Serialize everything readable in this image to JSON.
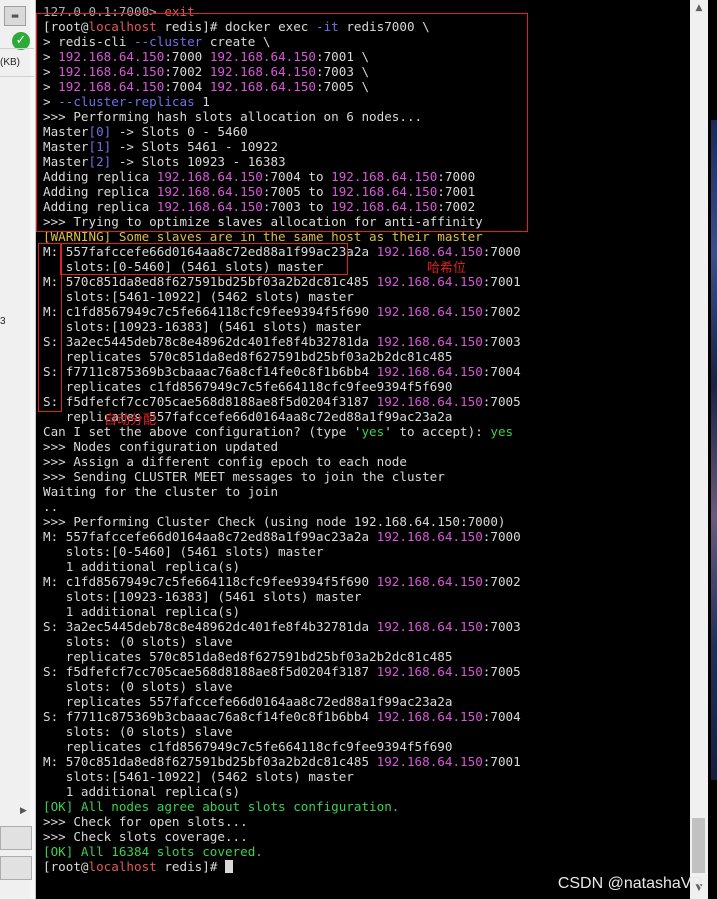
{
  "left_panel": {
    "kb_label": "(KB)",
    "number_label": "3"
  },
  "terminal": {
    "lines": [
      [
        {
          "t": "127.0.0.1:7000> ",
          "c": "c-dim"
        },
        {
          "t": "exit",
          "c": "c-red"
        }
      ],
      [
        {
          "t": "[root@",
          "c": ""
        },
        {
          "t": "localhost",
          "c": "c-red"
        },
        {
          "t": " redis]# docker exec ",
          "c": ""
        },
        {
          "t": "-it",
          "c": "c-cyn"
        },
        {
          "t": " redis7000 \\",
          "c": ""
        }
      ],
      [
        {
          "t": "> redis-cli ",
          "c": ""
        },
        {
          "t": "--cluster",
          "c": "c-cyn"
        },
        {
          "t": " create \\",
          "c": ""
        }
      ],
      [
        {
          "t": "> ",
          "c": ""
        },
        {
          "t": "192.168.64.150",
          "c": "c-mag"
        },
        {
          "t": ":7000 ",
          "c": ""
        },
        {
          "t": "192.168.64.150",
          "c": "c-mag"
        },
        {
          "t": ":7001 \\",
          "c": ""
        }
      ],
      [
        {
          "t": "> ",
          "c": ""
        },
        {
          "t": "192.168.64.150",
          "c": "c-mag"
        },
        {
          "t": ":7002 ",
          "c": ""
        },
        {
          "t": "192.168.64.150",
          "c": "c-mag"
        },
        {
          "t": ":7003 \\",
          "c": ""
        }
      ],
      [
        {
          "t": "> ",
          "c": ""
        },
        {
          "t": "192.168.64.150",
          "c": "c-mag"
        },
        {
          "t": ":7004 ",
          "c": ""
        },
        {
          "t": "192.168.64.150",
          "c": "c-mag"
        },
        {
          "t": ":7005 \\",
          "c": ""
        }
      ],
      [
        {
          "t": "> ",
          "c": ""
        },
        {
          "t": "--cluster-replicas",
          "c": "c-cyn"
        },
        {
          "t": " 1",
          "c": ""
        }
      ],
      [
        {
          "t": ">>> Performing hash slots allocation on 6 nodes...",
          "c": ""
        }
      ],
      [
        {
          "t": "Master",
          "c": ""
        },
        {
          "t": "[0]",
          "c": "c-cyn"
        },
        {
          "t": " -> Slots 0 - 5460",
          "c": ""
        }
      ],
      [
        {
          "t": "Master",
          "c": ""
        },
        {
          "t": "[1]",
          "c": "c-cyn"
        },
        {
          "t": " -> Slots 5461 - 10922",
          "c": ""
        }
      ],
      [
        {
          "t": "Master",
          "c": ""
        },
        {
          "t": "[2]",
          "c": "c-cyn"
        },
        {
          "t": " -> Slots 10923 - 16383",
          "c": ""
        }
      ],
      [
        {
          "t": "Adding replica ",
          "c": ""
        },
        {
          "t": "192.168.64.150",
          "c": "c-mag"
        },
        {
          "t": ":7004 to ",
          "c": ""
        },
        {
          "t": "192.168.64.150",
          "c": "c-mag"
        },
        {
          "t": ":7000",
          "c": ""
        }
      ],
      [
        {
          "t": "Adding replica ",
          "c": ""
        },
        {
          "t": "192.168.64.150",
          "c": "c-mag"
        },
        {
          "t": ":7005 to ",
          "c": ""
        },
        {
          "t": "192.168.64.150",
          "c": "c-mag"
        },
        {
          "t": ":7001",
          "c": ""
        }
      ],
      [
        {
          "t": "Adding replica ",
          "c": ""
        },
        {
          "t": "192.168.64.150",
          "c": "c-mag"
        },
        {
          "t": ":7003 to ",
          "c": ""
        },
        {
          "t": "192.168.64.150",
          "c": "c-mag"
        },
        {
          "t": ":7002",
          "c": ""
        }
      ],
      [
        {
          "t": ">>> Trying to optimize slaves allocation for anti-affinity",
          "c": ""
        }
      ],
      [
        {
          "t": "[WARNING] Some slaves are in the same host as their master",
          "c": "c-yel"
        }
      ],
      [
        {
          "t": "M: 557fafccefe66d0164aa8c72ed88a1f99ac23a2a ",
          "c": ""
        },
        {
          "t": "192.168.64.150",
          "c": "c-mag"
        },
        {
          "t": ":7000",
          "c": ""
        }
      ],
      [
        {
          "t": "   slots:[0-5460] (5461 slots) master",
          "c": ""
        }
      ],
      [
        {
          "t": "M: 570c851da8ed8f627591bd25bf03a2b2dc81c485 ",
          "c": ""
        },
        {
          "t": "192.168.64.150",
          "c": "c-mag"
        },
        {
          "t": ":7001",
          "c": ""
        }
      ],
      [
        {
          "t": "   slots:[5461-10922] (5462 slots) master",
          "c": ""
        }
      ],
      [
        {
          "t": "M: c1fd8567949c7c5fe664118cfc9fee9394f5f690 ",
          "c": ""
        },
        {
          "t": "192.168.64.150",
          "c": "c-mag"
        },
        {
          "t": ":7002",
          "c": ""
        }
      ],
      [
        {
          "t": "   slots:[10923-16383] (5461 slots) master",
          "c": ""
        }
      ],
      [
        {
          "t": "S: 3a2ec5445deb78c8e48962dc401fe8f4b32781da ",
          "c": ""
        },
        {
          "t": "192.168.64.150",
          "c": "c-mag"
        },
        {
          "t": ":7003",
          "c": ""
        }
      ],
      [
        {
          "t": "   replicates 570c851da8ed8f627591bd25bf03a2b2dc81c485",
          "c": ""
        }
      ],
      [
        {
          "t": "S: f7711c875369b3cbaaac76a8cf14fe0c8f1b6bb4 ",
          "c": ""
        },
        {
          "t": "192.168.64.150",
          "c": "c-mag"
        },
        {
          "t": ":7004",
          "c": ""
        }
      ],
      [
        {
          "t": "   replicates c1fd8567949c7c5fe664118cfc9fee9394f5f690",
          "c": ""
        }
      ],
      [
        {
          "t": "S: f5dfefcf7cc705cae568d8188ae8f5d0204f3187 ",
          "c": ""
        },
        {
          "t": "192.168.64.150",
          "c": "c-mag"
        },
        {
          "t": ":7005",
          "c": ""
        }
      ],
      [
        {
          "t": "   replicates 557fafccefe66d0164aa8c72ed88a1f99ac23a2a",
          "c": ""
        }
      ],
      [
        {
          "t": "Can I set the above configuration? (type '",
          "c": ""
        },
        {
          "t": "yes",
          "c": "c-grn"
        },
        {
          "t": "' to accept): ",
          "c": ""
        },
        {
          "t": "yes",
          "c": "c-grn"
        }
      ],
      [
        {
          "t": ">>> Nodes configuration updated",
          "c": ""
        }
      ],
      [
        {
          "t": ">>> Assign a different config epoch to each node",
          "c": ""
        }
      ],
      [
        {
          "t": ">>> Sending CLUSTER MEET messages to join the cluster",
          "c": ""
        }
      ],
      [
        {
          "t": "Waiting for the cluster to join",
          "c": ""
        }
      ],
      [
        {
          "t": "..",
          "c": ""
        }
      ],
      [
        {
          "t": ">>> Performing Cluster Check (using node 192.168.64.150:7000)",
          "c": ""
        }
      ],
      [
        {
          "t": "M: 557fafccefe66d0164aa8c72ed88a1f99ac23a2a ",
          "c": ""
        },
        {
          "t": "192.168.64.150",
          "c": "c-mag"
        },
        {
          "t": ":7000",
          "c": ""
        }
      ],
      [
        {
          "t": "   slots:[0-5460] (5461 slots) master",
          "c": ""
        }
      ],
      [
        {
          "t": "   1 additional replica(s)",
          "c": ""
        }
      ],
      [
        {
          "t": "M: c1fd8567949c7c5fe664118cfc9fee9394f5f690 ",
          "c": ""
        },
        {
          "t": "192.168.64.150",
          "c": "c-mag"
        },
        {
          "t": ":7002",
          "c": ""
        }
      ],
      [
        {
          "t": "   slots:[10923-16383] (5461 slots) master",
          "c": ""
        }
      ],
      [
        {
          "t": "   1 additional replica(s)",
          "c": ""
        }
      ],
      [
        {
          "t": "S: 3a2ec5445deb78c8e48962dc401fe8f4b32781da ",
          "c": ""
        },
        {
          "t": "192.168.64.150",
          "c": "c-mag"
        },
        {
          "t": ":7003",
          "c": ""
        }
      ],
      [
        {
          "t": "   slots: (0 slots) slave",
          "c": ""
        }
      ],
      [
        {
          "t": "   replicates 570c851da8ed8f627591bd25bf03a2b2dc81c485",
          "c": ""
        }
      ],
      [
        {
          "t": "S: f5dfefcf7cc705cae568d8188ae8f5d0204f3187 ",
          "c": ""
        },
        {
          "t": "192.168.64.150",
          "c": "c-mag"
        },
        {
          "t": ":7005",
          "c": ""
        }
      ],
      [
        {
          "t": "   slots: (0 slots) slave",
          "c": ""
        }
      ],
      [
        {
          "t": "   replicates 557fafccefe66d0164aa8c72ed88a1f99ac23a2a",
          "c": ""
        }
      ],
      [
        {
          "t": "S: f7711c875369b3cbaaac76a8cf14fe0c8f1b6bb4 ",
          "c": ""
        },
        {
          "t": "192.168.64.150",
          "c": "c-mag"
        },
        {
          "t": ":7004",
          "c": ""
        }
      ],
      [
        {
          "t": "   slots: (0 slots) slave",
          "c": ""
        }
      ],
      [
        {
          "t": "   replicates c1fd8567949c7c5fe664118cfc9fee9394f5f690",
          "c": ""
        }
      ],
      [
        {
          "t": "M: 570c851da8ed8f627591bd25bf03a2b2dc81c485 ",
          "c": ""
        },
        {
          "t": "192.168.64.150",
          "c": "c-mag"
        },
        {
          "t": ":7001",
          "c": ""
        }
      ],
      [
        {
          "t": "   slots:[5461-10922] (5462 slots) master",
          "c": ""
        }
      ],
      [
        {
          "t": "   1 additional replica(s)",
          "c": ""
        }
      ],
      [
        {
          "t": "[OK] All nodes agree about slots configuration.",
          "c": "c-grn"
        }
      ],
      [
        {
          "t": ">>> Check for open slots...",
          "c": ""
        }
      ],
      [
        {
          "t": ">>> Check slots coverage...",
          "c": ""
        }
      ],
      [
        {
          "t": "[OK] All 16384 slots covered.",
          "c": "c-grn"
        }
      ],
      [
        {
          "t": "[root@",
          "c": ""
        },
        {
          "t": "localhost",
          "c": "c-red"
        },
        {
          "t": " redis]# ",
          "c": ""
        }
      ]
    ]
  },
  "annotations": {
    "hash_slot_label": "哈希位",
    "auto_assign_label": "自动分配"
  },
  "watermark": "CSDN @natashaVR"
}
